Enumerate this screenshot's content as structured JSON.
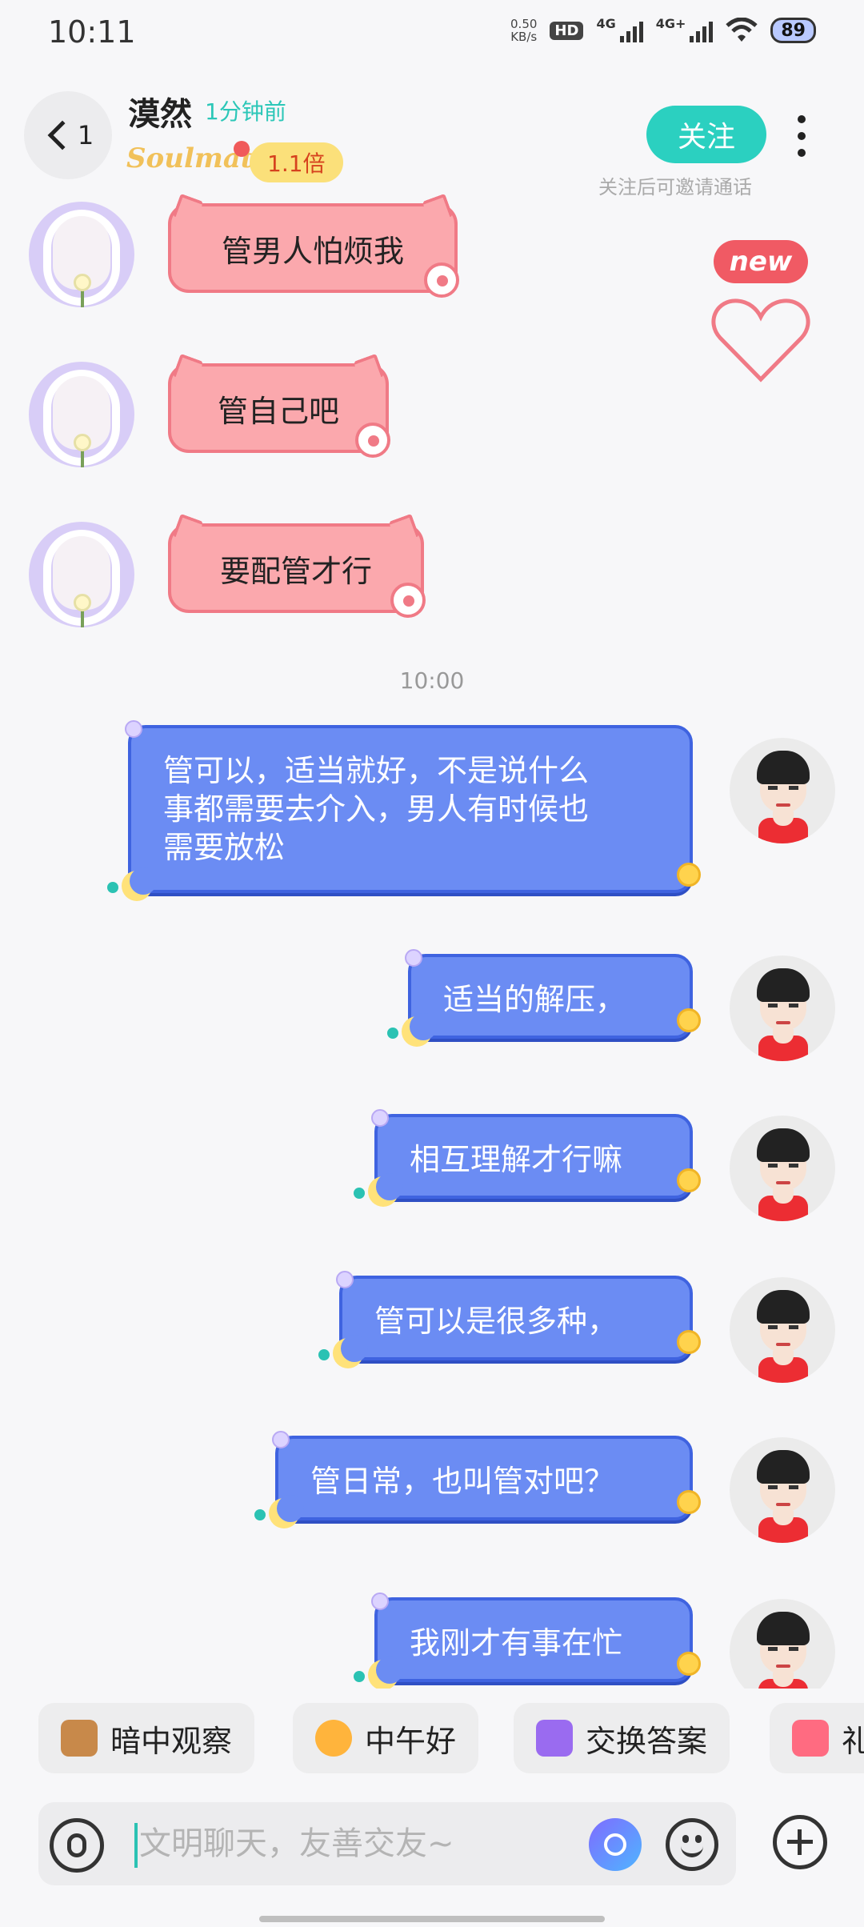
{
  "status_bar": {
    "time": "10:11",
    "speed_value": "0.50",
    "speed_unit": "KB/s",
    "hd_label": "HD",
    "net1": "4G",
    "net2": "4G+",
    "battery": "89"
  },
  "header": {
    "back_count": "1",
    "name": "漠然",
    "last_seen": "1分钟前",
    "brand": "Soulmate",
    "multiplier": "1.1倍",
    "follow_label": "关注",
    "follow_hint": "关注后可邀请通话",
    "new_badge": "new"
  },
  "messages": {
    "incoming": [
      {
        "text": "管男人怕烦我"
      },
      {
        "text": "管自己吧"
      },
      {
        "text": "要配管才行"
      }
    ],
    "timestamp": "10:00",
    "outgoing": [
      {
        "line1": "管可以，适当就好，不是说什么",
        "line2": "事都需要去介入，男人有时候也",
        "line3": "需要放松"
      },
      {
        "text": "适当的解压，"
      },
      {
        "text": "相互理解才行嘛"
      },
      {
        "text": "管可以是很多种，"
      },
      {
        "text": "管日常，也叫管对吧？"
      },
      {
        "text": "我刚才有事在忙"
      }
    ]
  },
  "quick_replies": [
    {
      "label": "暗中观察",
      "icon": "peek-bear-icon"
    },
    {
      "label": "中午好",
      "icon": "sun-sunglasses-icon"
    },
    {
      "label": "交换答案",
      "icon": "exchange-icon"
    },
    {
      "label": "礼",
      "icon": "gift-icon"
    }
  ],
  "input": {
    "placeholder": "文明聊天，友善交友~"
  },
  "colors": {
    "accent_teal": "#2bd0c0",
    "incoming_bubble": "#fba8ad",
    "outgoing_bubble": "#6b8cf3",
    "badge_yellow": "#fbe07a"
  }
}
